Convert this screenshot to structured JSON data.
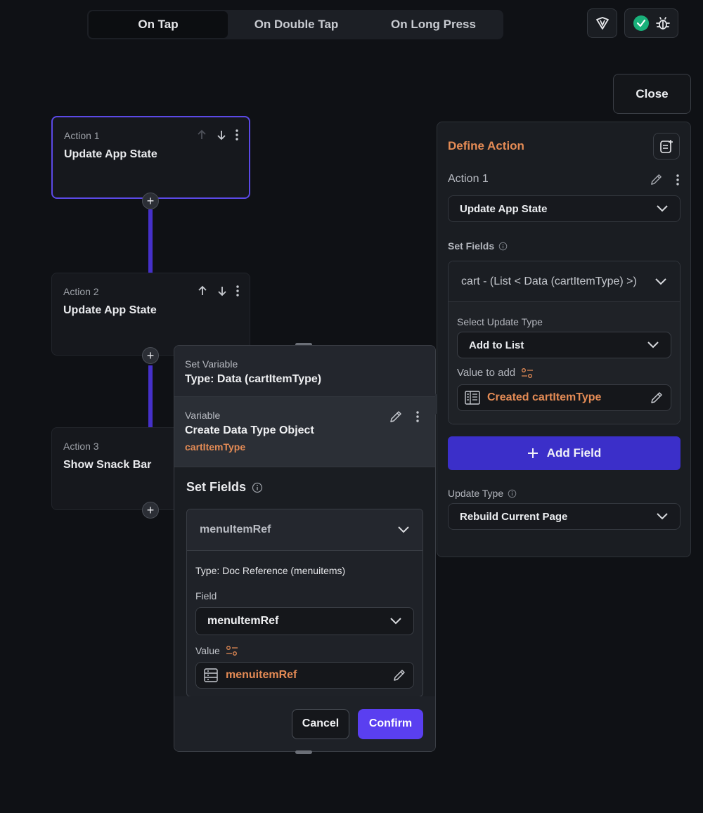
{
  "tabs": [
    {
      "label": "On Tap",
      "active": true
    },
    {
      "label": "On Double Tap",
      "active": false
    },
    {
      "label": "On Long Press",
      "active": false
    }
  ],
  "close_label": "Close",
  "actions": [
    {
      "label": "Action 1",
      "title": "Update App State"
    },
    {
      "label": "Action 2",
      "title": "Update App State"
    },
    {
      "label": "Action 3",
      "title": "Show Snack Bar"
    }
  ],
  "popup": {
    "set_variable_label": "Set Variable",
    "type_label": "Type: Data (cartItemType)",
    "variable_label": "Variable",
    "variable_title": "Create Data Type Object",
    "variable_type": "cartItemType",
    "set_fields_header": "Set Fields",
    "field_name": "menuItemRef",
    "field_type": "Type: Doc Reference (menuitems)",
    "field_label": "Field",
    "field_value_select": "menuItemRef",
    "value_label": "Value",
    "value_text": "menuitemRef",
    "cancel_label": "Cancel",
    "confirm_label": "Confirm"
  },
  "right_panel": {
    "title": "Define Action",
    "action_label": "Action 1",
    "action_select": "Update App State",
    "set_fields_label": "Set Fields",
    "cart_field": "cart - (List < Data (cartItemType) >)",
    "update_type_label": "Select Update Type",
    "update_type_value": "Add to List",
    "value_to_add_label": "Value to add",
    "value_to_add_text": "Created cartItemType",
    "add_field_label": "Add Field",
    "update_type2_label": "Update Type",
    "update_type2_value": "Rebuild Current Page"
  },
  "colors": {
    "accent": "#5a3ff0",
    "orange": "#e48b55",
    "success": "#19b07a"
  }
}
